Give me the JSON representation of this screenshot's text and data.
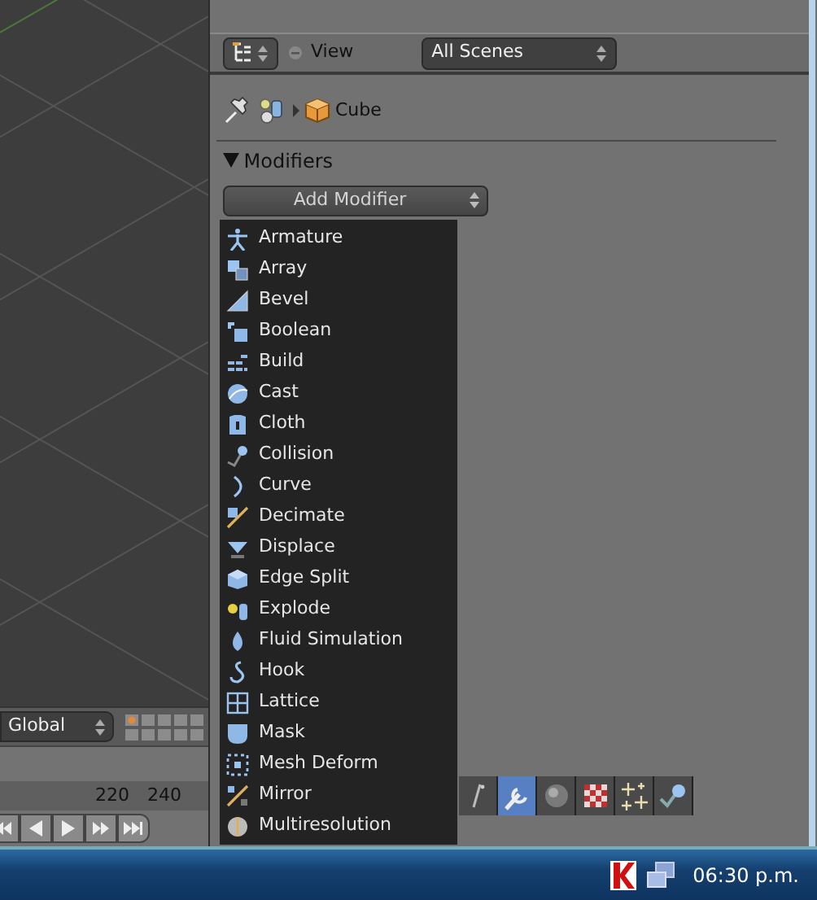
{
  "viewport": {
    "orientation": "Global"
  },
  "timeline": {
    "ticks": [
      "220",
      "240"
    ]
  },
  "outliner": {
    "display_label": "View",
    "display_value": "All Scenes"
  },
  "properties": {
    "breadcrumb": "Cube",
    "panel": {
      "title": "Modifiers",
      "expanded": true
    },
    "add_button": "Add Modifier",
    "menu": [
      {
        "label": "Armature"
      },
      {
        "label": "Array"
      },
      {
        "label": "Bevel"
      },
      {
        "label": "Boolean"
      },
      {
        "label": "Build"
      },
      {
        "label": "Cast"
      },
      {
        "label": "Cloth"
      },
      {
        "label": "Collision"
      },
      {
        "label": "Curve"
      },
      {
        "label": "Decimate"
      },
      {
        "label": "Displace"
      },
      {
        "label": "Edge Split"
      },
      {
        "label": "Explode"
      },
      {
        "label": "Fluid Simulation"
      },
      {
        "label": "Hook"
      },
      {
        "label": "Lattice"
      },
      {
        "label": "Mask"
      },
      {
        "label": "Mesh Deform"
      },
      {
        "label": "Mirror"
      },
      {
        "label": "Multiresolution"
      }
    ],
    "tabs": [
      {
        "selected": false
      },
      {
        "selected": true
      },
      {
        "selected": false
      },
      {
        "selected": false
      },
      {
        "selected": false
      },
      {
        "selected": false
      }
    ]
  },
  "taskbar": {
    "clock": "06:30 p.m."
  }
}
